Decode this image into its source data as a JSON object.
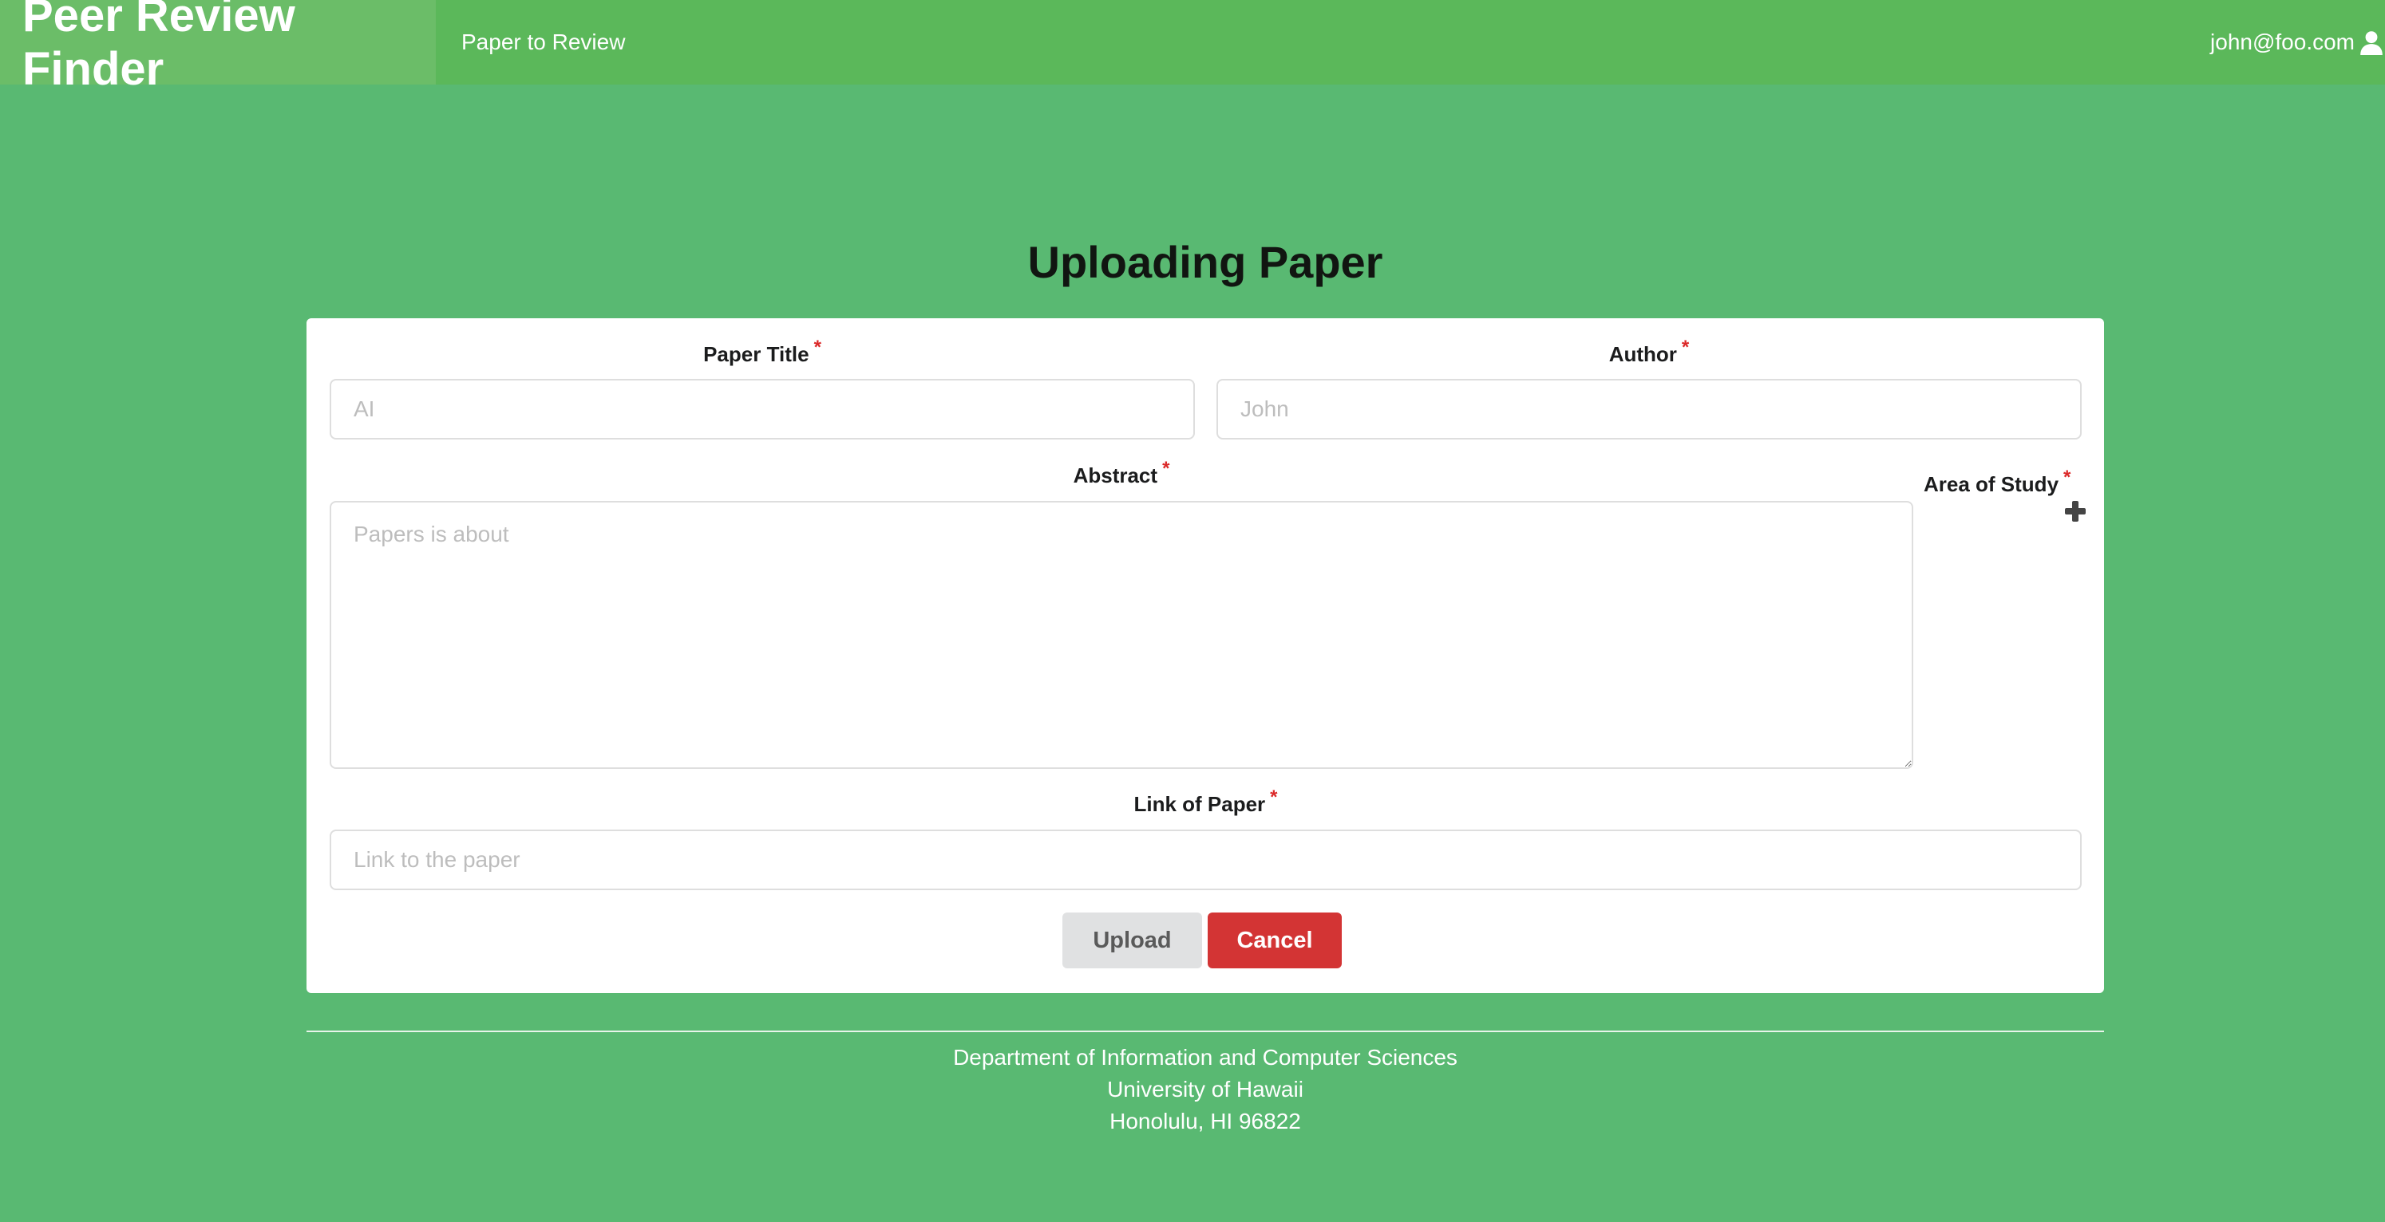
{
  "navbar": {
    "brand": "Peer Review Finder",
    "link": "Paper to Review",
    "user_email": "john@foo.com",
    "user_icon": "user-icon"
  },
  "page": {
    "title": "Uploading Paper"
  },
  "form": {
    "paper_title": {
      "label": "Paper Title",
      "required_mark": "*",
      "placeholder": "AI"
    },
    "author": {
      "label": "Author",
      "required_mark": "*",
      "placeholder": "John"
    },
    "abstract": {
      "label": "Abstract",
      "required_mark": "*",
      "placeholder": "Papers is about"
    },
    "area_of_study": {
      "label": "Area of Study",
      "required_mark": "*",
      "add_icon": "plus-icon"
    },
    "link": {
      "label": "Link of Paper",
      "required_mark": "*",
      "placeholder": "Link to the paper"
    },
    "buttons": {
      "upload": "Upload",
      "cancel": "Cancel"
    }
  },
  "footer": {
    "line1": "Department of Information and Computer Sciences",
    "line2": "University of Hawaii",
    "line3": "Honolulu, HI 96822"
  },
  "colors": {
    "background": "#59b972",
    "navbar": "#5bb85a",
    "brand_bg": "#6bbd68",
    "required": "#db2828",
    "cancel": "#d33434",
    "upload": "#e0e1e2"
  }
}
